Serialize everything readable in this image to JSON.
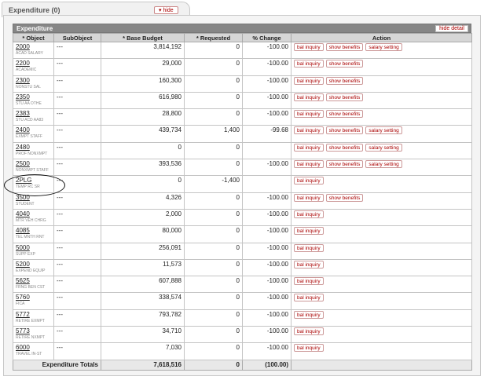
{
  "tab": {
    "title": "Expenditure (0)",
    "hide_label": "▾ hide"
  },
  "section": {
    "title": "Expenditure",
    "hide_detail_label": "hide detail"
  },
  "columns": [
    "* Object",
    "SubObject",
    "* Base Budget",
    "* Requested",
    "% Change",
    "Action"
  ],
  "actions": {
    "bal": "bal inquiry",
    "benefits": "show benefits",
    "salary": "salary setting"
  },
  "rows": [
    {
      "code": "2000",
      "desc": "ACAD SALARY",
      "sub": "---",
      "base": "3,814,192",
      "req": "0",
      "pct": "-100.00",
      "benefits": true,
      "salary": true
    },
    {
      "code": "2200",
      "desc": "ACADEMIC",
      "sub": "---",
      "base": "29,000",
      "req": "0",
      "pct": "-100.00",
      "benefits": true,
      "salary": false
    },
    {
      "code": "2300",
      "desc": "NONSTU SAL",
      "sub": "---",
      "base": "160,300",
      "req": "0",
      "pct": "-100.00",
      "benefits": true,
      "salary": false
    },
    {
      "code": "2350",
      "desc": "STU AA OTHE",
      "sub": "---",
      "base": "616,980",
      "req": "0",
      "pct": "-100.00",
      "benefits": true,
      "salary": false
    },
    {
      "code": "2383",
      "desc": "STU ACD AA83",
      "sub": "---",
      "base": "28,800",
      "req": "0",
      "pct": "-100.00",
      "benefits": true,
      "salary": false
    },
    {
      "code": "2400",
      "desc": "EXMPT STAFF",
      "sub": "---",
      "base": "439,734",
      "req": "1,400",
      "pct": "-99.68",
      "benefits": true,
      "salary": true
    },
    {
      "code": "2480",
      "desc": "PROF NONXMPT",
      "sub": "---",
      "base": "0",
      "req": "0",
      "pct": "",
      "benefits": true,
      "salary": true
    },
    {
      "code": "2500",
      "desc": "NONXMPT STAFF",
      "sub": "---",
      "base": "393,536",
      "req": "0",
      "pct": "-100.00",
      "benefits": true,
      "salary": true
    },
    {
      "code": "2PLG",
      "desc": "TEMP RC SR",
      "sub": "---",
      "base": "0",
      "req": "-1,400",
      "pct": "",
      "benefits": false,
      "salary": false
    },
    {
      "code": "3500",
      "desc": "STUDENT",
      "sub": "---",
      "base": "4,326",
      "req": "0",
      "pct": "-100.00",
      "benefits": true,
      "salary": false
    },
    {
      "code": "4040",
      "desc": "MTR VEH CHRG",
      "sub": "---",
      "base": "2,000",
      "req": "0",
      "pct": "-100.00",
      "benefits": false,
      "salary": false
    },
    {
      "code": "4085",
      "desc": "TEL MNTH RNT",
      "sub": "---",
      "base": "80,000",
      "req": "0",
      "pct": "-100.00",
      "benefits": false,
      "salary": false
    },
    {
      "code": "5000",
      "desc": "SUPP EXP",
      "sub": "---",
      "base": "256,091",
      "req": "0",
      "pct": "-100.00",
      "benefits": false,
      "salary": false
    },
    {
      "code": "5200",
      "desc": "EXPEND EQUIP",
      "sub": "---",
      "base": "11,573",
      "req": "0",
      "pct": "-100.00",
      "benefits": false,
      "salary": false
    },
    {
      "code": "5625",
      "desc": "FRNG BEN CST",
      "sub": "---",
      "base": "607,888",
      "req": "0",
      "pct": "-100.00",
      "benefits": false,
      "salary": false
    },
    {
      "code": "5760",
      "desc": "FICA",
      "sub": "---",
      "base": "338,574",
      "req": "0",
      "pct": "-100.00",
      "benefits": false,
      "salary": false
    },
    {
      "code": "5772",
      "desc": "RETIRE EXMPT",
      "sub": "---",
      "base": "793,782",
      "req": "0",
      "pct": "-100.00",
      "benefits": false,
      "salary": false
    },
    {
      "code": "5773",
      "desc": "RETIRE NXMPT",
      "sub": "---",
      "base": "34,710",
      "req": "0",
      "pct": "-100.00",
      "benefits": false,
      "salary": false
    },
    {
      "code": "6000",
      "desc": "TRAVEL IN-ST",
      "sub": "---",
      "base": "7,030",
      "req": "0",
      "pct": "-100.00",
      "benefits": false,
      "salary": false
    }
  ],
  "totals": {
    "label": "Expenditure Totals",
    "base": "7,618,516",
    "req": "0",
    "pct": "(100.00)"
  }
}
